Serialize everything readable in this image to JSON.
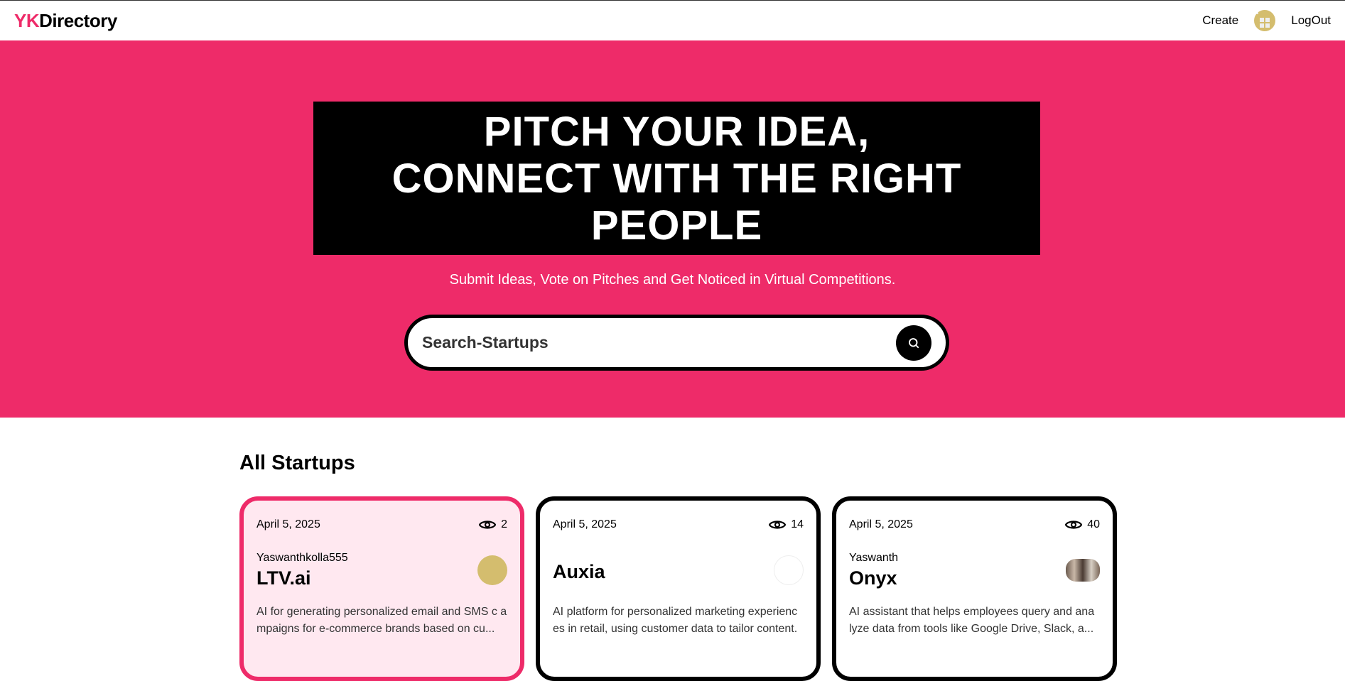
{
  "nav": {
    "logo_accent": "YK",
    "logo_rest": "Directory",
    "create": "Create",
    "logout": "LogOut"
  },
  "hero": {
    "headline_1": "PITCH YOUR IDEA,",
    "headline_2": "CONNECT WITH THE RIGHT",
    "headline_3": "PEOPLE",
    "subtitle": "Submit Ideas, Vote on Pitches and Get Noticed in Virtual Competitions.",
    "search_placeholder": "Search-Startups"
  },
  "colors": {
    "brand": "#ee2b69",
    "card_active_bg": "#ffe8f0"
  },
  "startups": {
    "title": "All Startups",
    "items": [
      {
        "date": "April 5, 2025",
        "views": "2",
        "author": "Yaswanthkolla555",
        "name": "LTV.ai",
        "description": "AI for generating personalized email and SMS c ampaigns for e-commerce brands based on cu..."
      },
      {
        "date": "April 5, 2025",
        "views": "14",
        "author": "",
        "name": "Auxia",
        "description": "AI platform for personalized marketing experienc es in retail, using customer data to tailor content."
      },
      {
        "date": "April 5, 2025",
        "views": "40",
        "author": "Yaswanth",
        "name": "Onyx",
        "description": "AI assistant that helps employees query and ana lyze data from tools like Google Drive, Slack, a..."
      }
    ]
  }
}
